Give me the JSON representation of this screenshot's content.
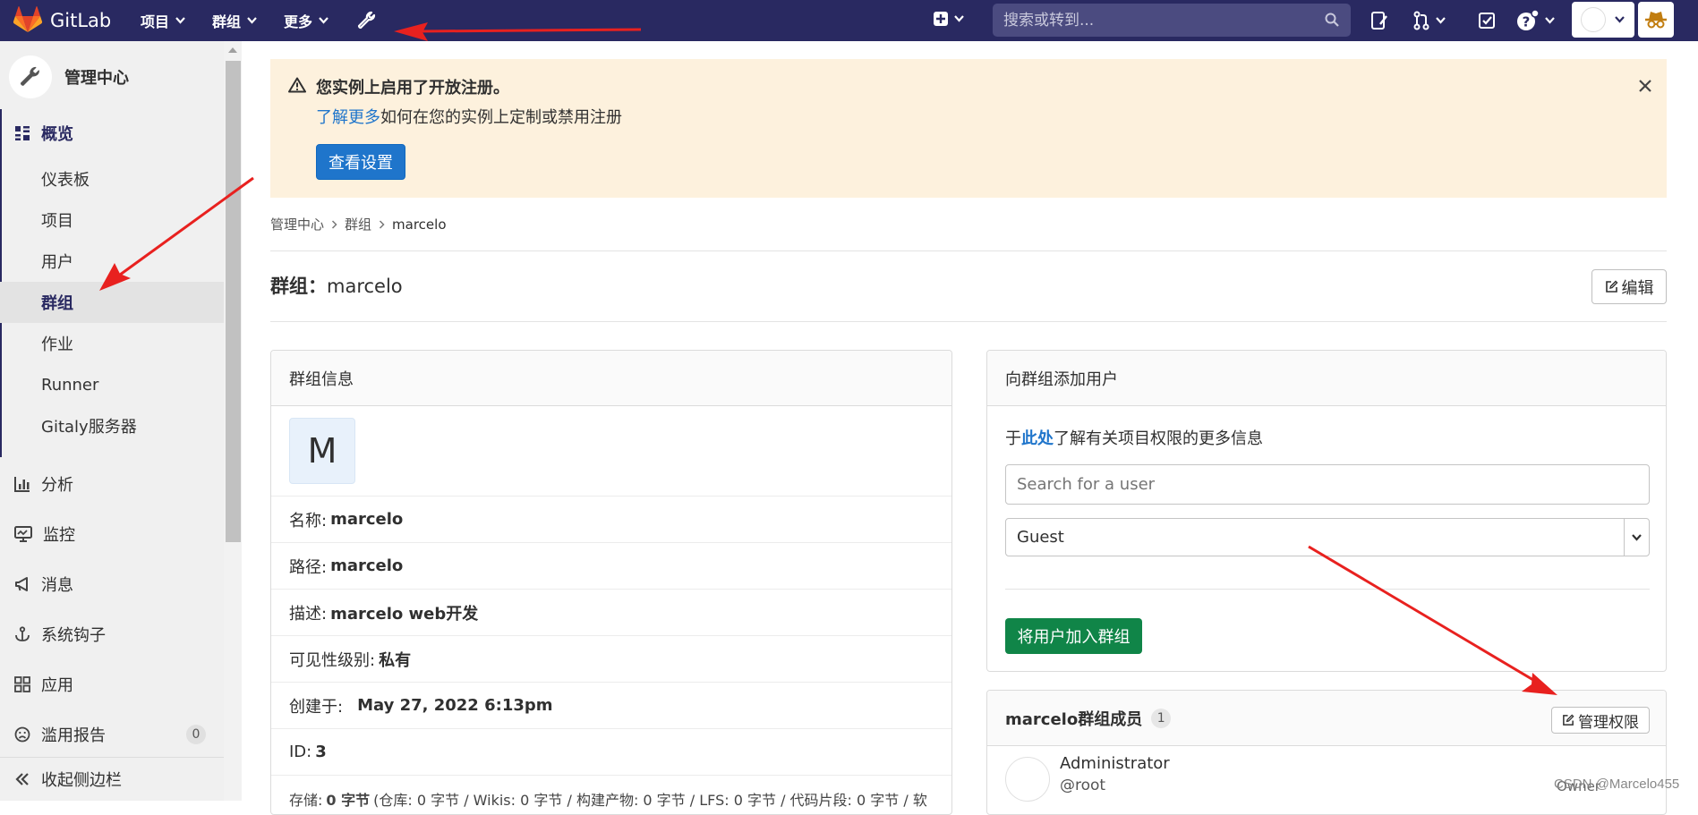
{
  "topbar": {
    "brand": "GitLab",
    "nav": [
      {
        "label": "项目"
      },
      {
        "label": "群组"
      },
      {
        "label": "更多"
      }
    ],
    "search_placeholder": "搜索或转到..."
  },
  "sidebar": {
    "title": "管理中心",
    "overview": "概览",
    "sub_items": [
      "仪表板",
      "项目",
      "用户",
      "群组",
      "作业",
      "Runner",
      "Gitaly服务器"
    ],
    "sections": [
      "分析",
      "监控",
      "消息",
      "系统钩子",
      "应用",
      "滥用报告"
    ],
    "abuse_count": "0",
    "collapse": "收起侧边栏"
  },
  "alert": {
    "title": "您实例上启用了开放注册。",
    "link": "了解更多",
    "text": "如何在您的实例上定制或禁用注册",
    "button": "查看设置"
  },
  "breadcrumb": [
    "管理中心",
    "群组",
    "marcelo"
  ],
  "page": {
    "title_prefix": "群组：",
    "title_name": "marcelo",
    "edit_button": "编辑"
  },
  "group_info": {
    "header": "群组信息",
    "avatar_letter": "M",
    "rows": [
      {
        "label": "名称:",
        "value": "marcelo"
      },
      {
        "label": "路径:",
        "value": "marcelo"
      },
      {
        "label": "描述:",
        "value": "marcelo web开发"
      },
      {
        "label": "可见性级别:",
        "value": "私有"
      },
      {
        "label": "创建于:",
        "value": "May 27, 2022 6:13pm"
      },
      {
        "label": "ID:",
        "value": "3"
      }
    ],
    "storage_label": "存储:",
    "storage_value": "0 字节",
    "storage_rest": "(仓库: 0 字节 / Wikis: 0 字节 / 构建产物: 0 字节 / LFS: 0 字节 / 代码片段: 0 字节 / 软"
  },
  "add_user": {
    "header": "向群组添加用户",
    "help_prefix": "于",
    "help_link": "此处",
    "help_suffix": "了解有关项目权限的更多信息",
    "search_placeholder": "Search for a user",
    "role_value": "Guest",
    "submit_button": "将用户加入群组"
  },
  "members": {
    "title": "marcelo群组成员",
    "count": "1",
    "manage_button": "管理权限",
    "list": [
      {
        "name": "Administrator",
        "username": "@root",
        "role": "Owner"
      }
    ]
  },
  "watermark": "CSDN @Marcelo455",
  "colors": {
    "topbar": "#292961",
    "alert_bg": "#fdf1dd",
    "primary": "#1f75cb",
    "success": "#108548",
    "arrow": "#e02020"
  }
}
